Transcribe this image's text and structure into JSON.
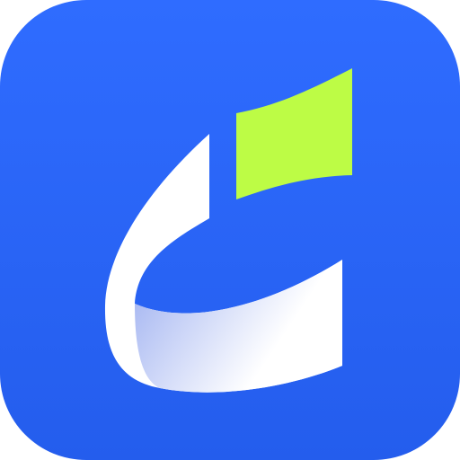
{
  "icon": {
    "name": "app-icon-letter-c-with-flag",
    "colors": {
      "background_top": "#2f6cff",
      "background_bottom": "#245ded",
      "letter": "#ffffff",
      "letter_shadow": "#a9b9f2",
      "flag": "#bdfc45"
    }
  }
}
